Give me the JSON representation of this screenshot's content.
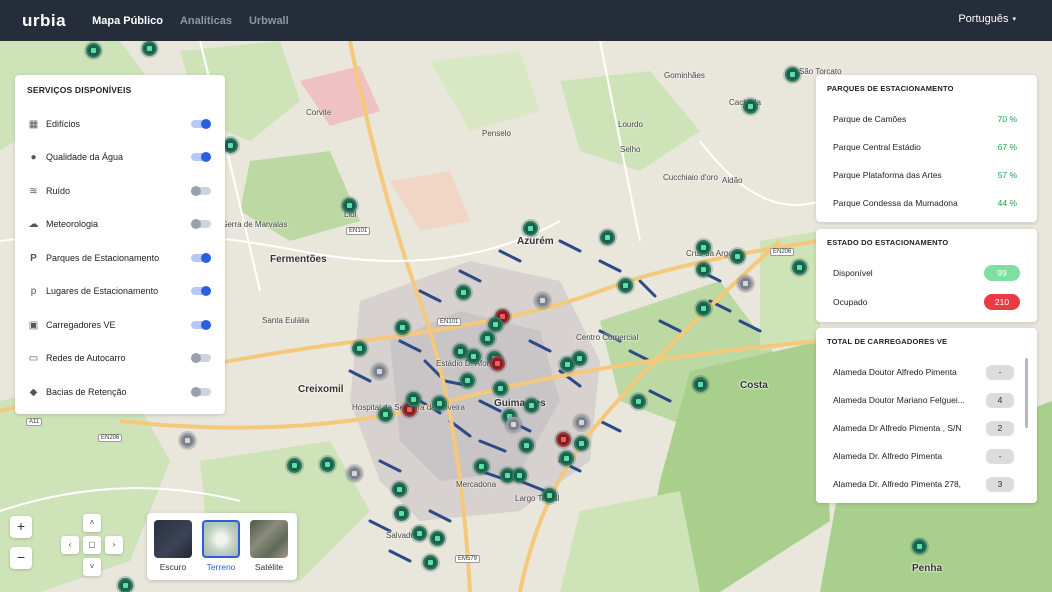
{
  "app": {
    "logo": "urbia",
    "nav": [
      "Mapa Público",
      "Analíticas",
      "Urbwall"
    ],
    "language": "Português"
  },
  "map": {
    "towns": [
      "Azurém",
      "Fermentões",
      "Creixomil",
      "Costa",
      "Penha",
      "Guimarães"
    ],
    "villages": [
      "Gominhães",
      "São Torcato",
      "Cacheda",
      "Corvite",
      "Penselo",
      "Lourdo",
      "Selho",
      "Aldão",
      "Santa Eulália",
      "Mercadona",
      "Lidl",
      "Cruz da Argola",
      "Hospital da Senhora da Oliveira",
      "Estádio D. Afonso",
      "Largo Toural",
      "Centro Comercial",
      "Serra de Marvalas",
      "Cucchiaio d'oro",
      "Salvador"
    ],
    "roads": [
      "EN101",
      "EN206",
      "EN101",
      "A11",
      "EN206",
      "EM579"
    ]
  },
  "services": {
    "title": "SERVIÇOS DISPONÍVEIS",
    "items": [
      {
        "label": "Edifícios",
        "icon": "building-icon",
        "enabled": true
      },
      {
        "label": "Qualidade da Água",
        "icon": "water-drop-icon",
        "enabled": true
      },
      {
        "label": "Ruído",
        "icon": "noise-icon",
        "enabled": false
      },
      {
        "label": "Meteorologia",
        "icon": "cloud-icon",
        "enabled": false
      },
      {
        "label": "Parques de Estacionamento",
        "icon": "parking-icon",
        "enabled": true
      },
      {
        "label": "Lugares de Estacionamento",
        "icon": "parking-spot-icon",
        "enabled": true
      },
      {
        "label": "Carregadores VE",
        "icon": "ev-charger-icon",
        "enabled": true
      },
      {
        "label": "Redes de Autocarro",
        "icon": "bus-icon",
        "enabled": false
      },
      {
        "label": "Bacias de Retenção",
        "icon": "basin-icon",
        "enabled": false
      }
    ]
  },
  "parking": {
    "title": "PARQUES DE ESTACIONAMENTO",
    "items": [
      {
        "name": "Parque de Camões",
        "pct": "70 %"
      },
      {
        "name": "Parque Central Estádio",
        "pct": "67 %"
      },
      {
        "name": "Parque Plataforma das Artes",
        "pct": "57 %"
      },
      {
        "name": "Parque Condessa da Mumadona",
        "pct": "44 %"
      }
    ]
  },
  "status": {
    "title": "ESTADO DO ESTACIONAMENTO",
    "items": [
      {
        "label": "Disponível",
        "value": "99",
        "color": "#7ee0a0"
      },
      {
        "label": "Ocupado",
        "value": "210",
        "color": "#e83b44"
      }
    ]
  },
  "chargers": {
    "title": "TOTAL DE CARREGADORES VE",
    "items": [
      {
        "name": "Alameda Doutor Alfredo Pimenta",
        "count": "-"
      },
      {
        "name": "Alameda Doutor Mariano Felguei...",
        "count": "4"
      },
      {
        "name": "Alameda Dr Alfredo Pimenta , S/N",
        "count": "2"
      },
      {
        "name": "Alameda Dr. Alfredo Pimenta",
        "count": "-"
      },
      {
        "name": "Alameda Dr. Alfredo Pimenta 278,",
        "count": "3"
      }
    ]
  },
  "controls": {
    "zoom_in": "+",
    "zoom_out": "−",
    "pan_up": "˄",
    "pan_down": "˅",
    "pan_left": "‹",
    "pan_right": "›"
  },
  "layers": [
    {
      "label": "Escuro",
      "selected": false
    },
    {
      "label": "Terreno",
      "selected": true
    },
    {
      "label": "Satélite",
      "selected": false
    }
  ]
}
